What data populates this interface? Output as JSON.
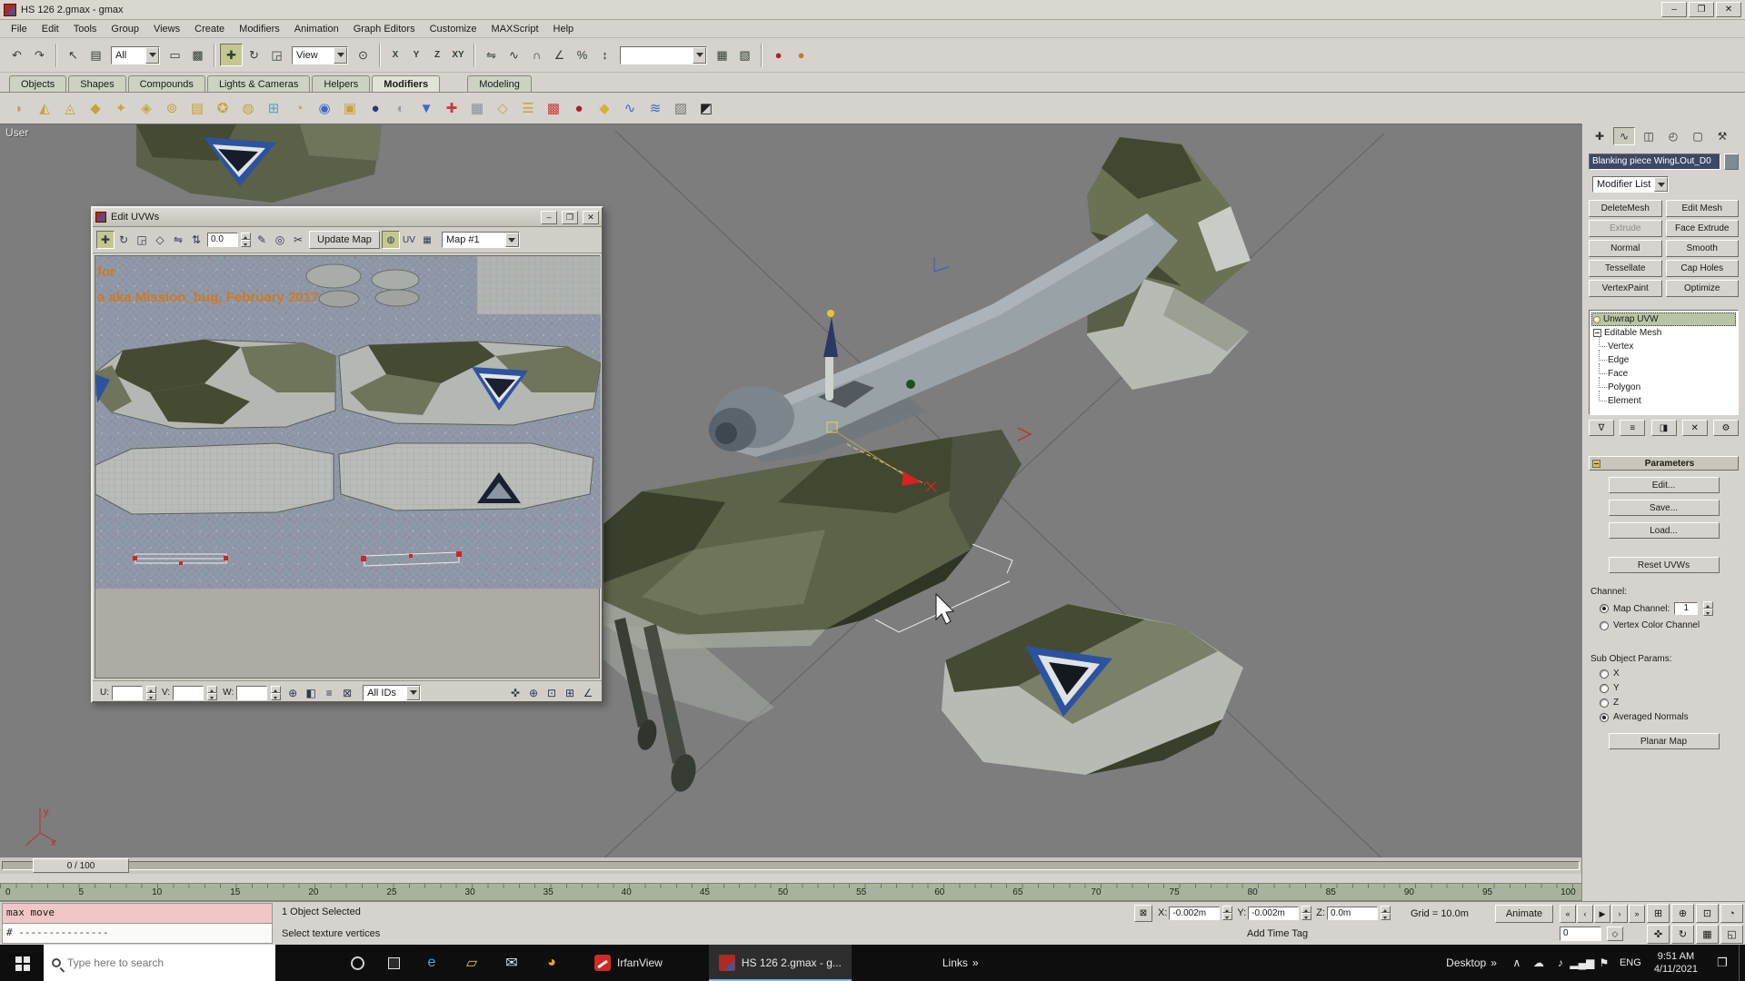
{
  "app": {
    "title": "HS 126 2.gmax - gmax"
  },
  "icons": {
    "minimize": "–",
    "maximize": "❐",
    "close": "✕"
  },
  "menubar": [
    "File",
    "Edit",
    "Tools",
    "Group",
    "Views",
    "Create",
    "Modifiers",
    "Animation",
    "Graph Editors",
    "Customize",
    "MAXScript",
    "Help"
  ],
  "toolbar": {
    "undo_redo": [
      {
        "name": "undo-button",
        "glyph": "↶"
      },
      {
        "name": "redo-button",
        "glyph": "↷"
      }
    ],
    "select_group": [
      {
        "name": "select-object-button",
        "glyph": "↖"
      },
      {
        "name": "select-by-name-button",
        "glyph": "▤"
      }
    ],
    "filter_label": "All",
    "region_group": [
      {
        "name": "rect-select-button",
        "glyph": "▭"
      },
      {
        "name": "crossing-toggle-button",
        "glyph": "▩"
      }
    ],
    "transform_group": [
      {
        "name": "move-button",
        "glyph": "✚",
        "cls": "active"
      },
      {
        "name": "rotate-button",
        "glyph": "↻"
      },
      {
        "name": "scale-button",
        "glyph": "◲"
      }
    ],
    "coord_label": "View",
    "center_group": [
      {
        "name": "use-center-button",
        "glyph": "⊙"
      }
    ],
    "axis_group": [
      {
        "name": "x-constraint-button",
        "glyph": "X"
      },
      {
        "name": "y-constraint-button",
        "glyph": "Y"
      },
      {
        "name": "z-constraint-button",
        "glyph": "Z"
      },
      {
        "name": "xy-constraint-button",
        "glyph": "XY"
      }
    ],
    "mirror_group": [
      {
        "name": "mirror-button",
        "glyph": "⇋"
      },
      {
        "name": "curve-editor-button",
        "glyph": "∿"
      }
    ],
    "snap_group": [
      {
        "name": "snap-toggle-button",
        "glyph": "∩"
      },
      {
        "name": "angle-snap-button",
        "glyph": "∠"
      },
      {
        "name": "percent-snap-button",
        "glyph": "%"
      },
      {
        "name": "spinner-snap-button",
        "glyph": "↕"
      }
    ],
    "named_sel_label": "",
    "grid_group": [
      {
        "name": "grid-toggle-button",
        "glyph": "▦"
      },
      {
        "name": "layer-toggle-button",
        "glyph": "▧"
      }
    ],
    "render_group": [
      {
        "name": "material-editor-button",
        "glyph": "●",
        "color": "#b02020"
      },
      {
        "name": "render-button",
        "glyph": "●",
        "color": "#d07818"
      }
    ]
  },
  "tabbar": [
    {
      "name": "tab-objects",
      "label": "Objects"
    },
    {
      "name": "tab-shapes",
      "label": "Shapes"
    },
    {
      "name": "tab-compounds",
      "label": "Compounds"
    },
    {
      "name": "tab-lights-cameras",
      "label": "Lights & Cameras"
    },
    {
      "name": "tab-helpers",
      "label": "Helpers"
    },
    {
      "name": "tab-modifiers",
      "label": "Modifiers",
      "cls": "active"
    },
    {
      "name": "tab-modeling",
      "label": "Modeling",
      "cls": "gap"
    }
  ],
  "modbar": [
    {
      "glyph": "◗",
      "color": "#c8a23c"
    },
    {
      "glyph": "◭",
      "color": "#c8a23c"
    },
    {
      "glyph": "◬",
      "color": "#c8a23c"
    },
    {
      "glyph": "◆",
      "color": "#c8a23c"
    },
    {
      "glyph": "✦",
      "color": "#c8a23c"
    },
    {
      "glyph": "◈",
      "color": "#c8a23c"
    },
    {
      "glyph": "⊚",
      "color": "#c8a23c"
    },
    {
      "glyph": "▤",
      "color": "#c8a23c"
    },
    {
      "glyph": "✪",
      "color": "#c8a23c"
    },
    {
      "glyph": "◍",
      "color": "#c8a23c"
    },
    {
      "glyph": "⊞",
      "color": "#4aa6c8"
    },
    {
      "glyph": "◔",
      "color": "#c8a23c"
    },
    {
      "glyph": "◉",
      "color": "#3c6ac8"
    },
    {
      "glyph": "▣",
      "color": "#c8a23c"
    },
    {
      "glyph": "●",
      "color": "#223a7a"
    },
    {
      "glyph": "◐",
      "color": "#9aa0a8"
    },
    {
      "glyph": "▼",
      "color": "#3c6ac8"
    },
    {
      "glyph": "✚",
      "color": "#c83c3c"
    },
    {
      "glyph": "▦",
      "color": "#8a8f96"
    },
    {
      "glyph": "◇",
      "color": "#c8a23c"
    },
    {
      "glyph": "☰",
      "color": "#c8a23c"
    },
    {
      "glyph": "▩",
      "color": "#c83c3c"
    },
    {
      "glyph": "●",
      "color": "#b02020"
    },
    {
      "glyph": "◆",
      "color": "#d8b030"
    },
    {
      "glyph": "∿",
      "color": "#3c6ac8"
    },
    {
      "glyph": "≋",
      "color": "#3c6ac8"
    },
    {
      "glyph": "▨",
      "color": "#777777"
    },
    {
      "glyph": "◩",
      "color": "#222222"
    }
  ],
  "viewport": {
    "label": "User",
    "axis_y": "y",
    "axis_x": "x"
  },
  "uvw": {
    "title": "Edit UVWs",
    "tools": [
      {
        "name": "uv-move-button",
        "glyph": "✚",
        "cls": "active"
      },
      {
        "name": "uv-rotate-button",
        "glyph": "↻"
      },
      {
        "name": "uv-scale-button",
        "glyph": "◲"
      },
      {
        "name": "uv-freeform-button",
        "glyph": "◇"
      },
      {
        "name": "uv-mirror-button",
        "glyph": "⇋"
      },
      {
        "name": "uv-flip-button",
        "glyph": "⇅"
      }
    ],
    "angle_value": "0.0",
    "tools2": [
      {
        "name": "uv-sketch-button",
        "glyph": "✎"
      },
      {
        "name": "uv-weld-button",
        "glyph": "◎"
      },
      {
        "name": "uv-break-button",
        "glyph": "✂"
      }
    ],
    "update_map_label": "Update Map",
    "right_tools": [
      {
        "name": "show-map-toggle",
        "glyph": "◍",
        "cls": "active"
      },
      {
        "name": "uv-space-toggle",
        "glyph": "UV"
      },
      {
        "name": "uv-options-button",
        "glyph": "▦"
      }
    ],
    "map_dropdown_label": "Map #1",
    "watermark_line1": "for",
    "watermark_line2": "a aka Mission_bug, February 2017",
    "bottom": {
      "u_label": "U:",
      "v_label": "V:",
      "w_label": "W:",
      "u_value": "",
      "v_value": "",
      "w_value": "",
      "mid_icons": [
        {
          "name": "uv-absolute-toggle",
          "glyph": "⊕"
        },
        {
          "name": "uv-copy-button",
          "glyph": "◧"
        },
        {
          "name": "uv-paste-button",
          "glyph": "≡"
        },
        {
          "name": "uv-lock-button",
          "glyph": "⊠"
        }
      ],
      "ids_label": "All IDs",
      "nav_icons": [
        {
          "name": "uv-pan-button",
          "glyph": "✜"
        },
        {
          "name": "uv-zoom-button",
          "glyph": "⊕"
        },
        {
          "name": "uv-zoom-region-button",
          "glyph": "⊡"
        },
        {
          "name": "uv-zoom-extents-button",
          "glyph": "⊞"
        },
        {
          "name": "uv-snap-button",
          "glyph": "∠"
        }
      ]
    }
  },
  "panel": {
    "tabs": [
      {
        "name": "create-tab",
        "glyph": "✚"
      },
      {
        "name": "modify-tab",
        "glyph": "∿",
        "cls": "active"
      },
      {
        "name": "hierarchy-tab",
        "glyph": "◫"
      },
      {
        "name": "motion-tab",
        "glyph": "◴"
      },
      {
        "name": "display-tab",
        "glyph": "▢"
      },
      {
        "name": "utilities-tab",
        "glyph": "⚒"
      }
    ],
    "object_name": "Blanking piece WingLOut_D0",
    "modifier_list_label": "Modifier List",
    "buttons": [
      {
        "name": "deletemesh-button",
        "label": "DeleteMesh"
      },
      {
        "name": "edit-mesh-button",
        "label": "Edit Mesh"
      },
      {
        "name": "extrude-button",
        "label": "Extrude",
        "cls": "disabled"
      },
      {
        "name": "face-extrude-button",
        "label": "Face Extrude"
      },
      {
        "name": "normal-button",
        "label": "Normal"
      },
      {
        "name": "smooth-button",
        "label": "Smooth"
      },
      {
        "name": "tessellate-button",
        "label": "Tessellate"
      },
      {
        "name": "cap-holes-button",
        "label": "Cap Holes"
      },
      {
        "name": "vertexpaint-button",
        "label": "VertexPaint"
      },
      {
        "name": "optimize-button",
        "label": "Optimize"
      }
    ],
    "stack": [
      {
        "name": "stack-unwrap-uvw",
        "label": "Unwrap UVW",
        "cls": "sel"
      },
      {
        "name": "stack-editable-mesh",
        "label": "Editable Mesh",
        "cls": "root"
      },
      {
        "name": "stack-vertex",
        "label": "Vertex",
        "cls": "leaf"
      },
      {
        "name": "stack-edge",
        "label": "Edge",
        "cls": "leaf"
      },
      {
        "name": "stack-face",
        "label": "Face",
        "cls": "leaf"
      },
      {
        "name": "stack-polygon",
        "label": "Polygon",
        "cls": "leaf"
      },
      {
        "name": "stack-element",
        "label": "Element",
        "cls": "leaf"
      }
    ],
    "stack_tools": [
      {
        "name": "pin-stack-button",
        "glyph": "∇"
      },
      {
        "name": "show-end-result-button",
        "glyph": "≡"
      },
      {
        "name": "make-unique-button",
        "glyph": "◨"
      },
      {
        "name": "remove-modifier-button",
        "glyph": "✕"
      },
      {
        "name": "configure-stack-button",
        "glyph": "⚙"
      }
    ],
    "rollout_title": "Parameters",
    "param_buttons": [
      {
        "name": "edit-uvws-button",
        "label": "Edit..."
      },
      {
        "name": "save-uvws-button",
        "label": "Save..."
      },
      {
        "name": "load-uvws-button",
        "label": "Load..."
      }
    ],
    "reset_label": "Reset UVWs",
    "channel_label": "Channel:",
    "map_channel_label": "Map Channel:",
    "map_channel_value": "1",
    "vertex_color_label": "Vertex Color Channel",
    "subobj_label": "Sub Object Params:",
    "axes": [
      {
        "name": "x-axis-radio",
        "label": "X"
      },
      {
        "name": "y-axis-radio",
        "label": "Y"
      },
      {
        "name": "z-axis-radio",
        "label": "Z"
      }
    ],
    "avg_normals_label": "Averaged Normals",
    "planar_label": "Planar Map"
  },
  "timeline": {
    "slider_label": "0 / 100",
    "ruler": [
      "0",
      "5",
      "10",
      "15",
      "20",
      "25",
      "30",
      "35",
      "40",
      "45",
      "50",
      "55",
      "60",
      "65",
      "70",
      "75",
      "80",
      "85",
      "90",
      "95",
      "100"
    ]
  },
  "status": {
    "listener_line1": "max move",
    "listener_line2": "# ---------------",
    "selection_text": "1 Object Selected",
    "prompt_text": "Select texture vertices",
    "add_time_tag": "Add Time Tag",
    "lock_glyph": "⊠",
    "coords": [
      {
        "name": "x-coordinate-field",
        "label": "X:",
        "value": "-0.002m"
      },
      {
        "name": "y-coordinate-field",
        "label": "Y:",
        "value": "-0.002m"
      },
      {
        "name": "z-coordinate-field",
        "label": "Z:",
        "value": "0.0m"
      }
    ],
    "grid_text": "Grid = 10.0m",
    "animate_label": "Animate",
    "frame_value": "0",
    "key_mode_glyph": "◇",
    "playback": [
      {
        "name": "go-to-start-button",
        "glyph": "«"
      },
      {
        "name": "previous-frame-button",
        "glyph": "‹"
      },
      {
        "name": "play-button",
        "glyph": "▶"
      },
      {
        "name": "next-frame-button",
        "glyph": "›"
      },
      {
        "name": "go-to-end-button",
        "glyph": "»"
      }
    ],
    "nav": [
      {
        "name": "zoom-extents-button",
        "glyph": "⊞"
      },
      {
        "name": "zoom-button",
        "glyph": "⊕"
      },
      {
        "name": "zoom-region-button",
        "glyph": "⊡"
      },
      {
        "name": "field-of-view-button",
        "glyph": "◔"
      },
      {
        "name": "pan-button",
        "glyph": "✜"
      },
      {
        "name": "arc-rotate-button",
        "glyph": "↻"
      },
      {
        "name": "grid-nav-button",
        "glyph": "▦"
      },
      {
        "name": "min-max-toggle-button",
        "glyph": "◱"
      }
    ]
  },
  "taskbar": {
    "search_placeholder": "Type here to search",
    "quick_icons": [
      {
        "name": "edge-icon",
        "glyph": "e",
        "color": "#4aa3e8"
      },
      {
        "name": "explorer-icon",
        "glyph": "▱",
        "color": "#e8c048"
      },
      {
        "name": "mail-icon",
        "glyph": "✉",
        "color": "#d9e6f2"
      },
      {
        "name": "firefox-icon",
        "glyph": "◕",
        "color": "#ff9a2a"
      }
    ],
    "apps": [
      {
        "label": "IrfanView"
      },
      {
        "label": "HS 126 2.gmax - g..."
      }
    ],
    "links_label": "Links",
    "desktop_label": "Desktop",
    "overflow_glyph": "»",
    "tray_chevron": "∧",
    "tray_icons": [
      {
        "name": "onedrive-icon",
        "glyph": "☁"
      },
      {
        "name": "speaker-icon",
        "glyph": "♪"
      },
      {
        "name": "network-icon",
        "glyph": "▂▄▆"
      },
      {
        "name": "antivirus-icon",
        "glyph": "⚑"
      }
    ],
    "lang_label": "ENG",
    "time_text": "9:51 AM",
    "date_text": "4/11/2021",
    "action_center_glyph": "❐"
  }
}
